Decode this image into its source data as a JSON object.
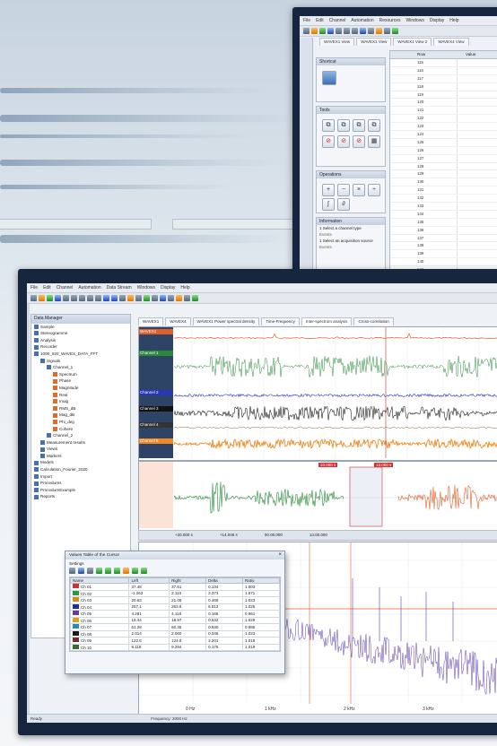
{
  "back_window": {
    "menu": [
      "File",
      "Edit",
      "Channel",
      "Automation",
      "Resources",
      "Windows",
      "Display",
      "Help"
    ],
    "tabs": [
      "WAVEX1 View",
      "WAVEX1 View",
      "WAVEX1 View 2",
      "WAVEX4 View"
    ],
    "panels": {
      "top": "Shortcut",
      "tools": "Tools",
      "ops": "Operations",
      "info": "Information"
    },
    "info_lines": [
      "1 Select a channel type",
      "Events",
      "1 Select an acquisition source",
      "Events"
    ],
    "ops_symbols": [
      "+",
      "−",
      "×",
      "÷",
      "∫",
      "∂"
    ],
    "table_headers": [
      "Row",
      "Value"
    ],
    "rows": [
      "115",
      "116",
      "117",
      "118",
      "119",
      "120",
      "121",
      "122",
      "123",
      "124",
      "125",
      "126",
      "127",
      "128",
      "129",
      "130",
      "131",
      "132",
      "133",
      "134",
      "135",
      "136",
      "137",
      "138",
      "139",
      "140",
      "141",
      "142"
    ]
  },
  "front_window": {
    "menu": [
      "File",
      "Edit",
      "Channel",
      "Automation",
      "Data Stream",
      "Windows",
      "Display",
      "Help"
    ],
    "tabs": [
      "WAVEX1",
      "WAVEX4",
      "WAVEX1 Power spectral density",
      "Time-Frequency",
      "Inter-spectrum analysis",
      "Cross-correlation"
    ],
    "tree_title": "Data Manager",
    "tree": [
      {
        "indent": 0,
        "label": "Sample"
      },
      {
        "indent": 0,
        "label": "Stereogramme"
      },
      {
        "indent": 0,
        "label": "Analysis"
      },
      {
        "indent": 0,
        "label": "Recorder"
      },
      {
        "indent": 0,
        "label": "1000_020_WAVEX_DATA_FFT"
      },
      {
        "indent": 1,
        "label": "Signals"
      },
      {
        "indent": 2,
        "label": "Channel_1"
      },
      {
        "indent": 3,
        "label": "Spectrum"
      },
      {
        "indent": 3,
        "label": "Phase"
      },
      {
        "indent": 3,
        "label": "Magnitude"
      },
      {
        "indent": 3,
        "label": "Real"
      },
      {
        "indent": 3,
        "label": "Imag"
      },
      {
        "indent": 3,
        "label": "RMS_dB"
      },
      {
        "indent": 3,
        "label": "Mag_dB"
      },
      {
        "indent": 3,
        "label": "Phi_deg"
      },
      {
        "indent": 3,
        "label": "Cohere"
      },
      {
        "indent": 2,
        "label": "Channel_2"
      },
      {
        "indent": 1,
        "label": "Measurement results"
      },
      {
        "indent": 1,
        "label": "Views"
      },
      {
        "indent": 1,
        "label": "Markers"
      },
      {
        "indent": 0,
        "label": "Models"
      },
      {
        "indent": 0,
        "label": "Calculation_Fourier_2020"
      },
      {
        "indent": 0,
        "label": "Import"
      },
      {
        "indent": 0,
        "label": "Procedures"
      },
      {
        "indent": 0,
        "label": "ProcedureExample"
      },
      {
        "indent": 0,
        "label": "Reports"
      }
    ],
    "channel_labels": [
      "WAVEX1",
      "Channel 1",
      "Channel 2",
      "Channel 3",
      "Channel 4",
      "Channel 5"
    ],
    "marker_readout": [
      "10.000 s",
      "13.000 s"
    ],
    "pos_readouts": [
      "+20.000 s",
      "+14.048 s",
      "00.00.000",
      "13.00.000"
    ],
    "dialog": {
      "title": "Values Table of the Cursor",
      "settings": "Settings",
      "headers": [
        "Name",
        "Left",
        "Right",
        "Delta",
        "Ratio"
      ],
      "rows": [
        {
          "color": "#d23232",
          "name": "Ch 01",
          "left": "37.48",
          "right": "37.61",
          "delta": "0.134",
          "ratio": "1.003"
        },
        {
          "color": "#2a9a3a",
          "name": "Ch 02",
          "left": "-1.263",
          "right": "2.110",
          "delta": "3.373",
          "ratio": "1.671"
        },
        {
          "color": "#d88a1c",
          "name": "Ch 03",
          "left": "20.63",
          "right": "21.09",
          "delta": "0.468",
          "ratio": "1.023"
        },
        {
          "color": "#1a2ea8",
          "name": "Ch 04",
          "left": "257.1",
          "right": "263.6",
          "delta": "6.512",
          "ratio": "1.025"
        },
        {
          "color": "#6a3a9a",
          "name": "Ch 05",
          "left": "4.281",
          "right": "4.116",
          "delta": "0.165",
          "ratio": "0.961"
        },
        {
          "color": "#e0a01c",
          "name": "Ch 06",
          "left": "18.44",
          "right": "18.97",
          "delta": "0.532",
          "ratio": "1.029"
        },
        {
          "color": "#2a8ab0",
          "name": "Ch 07",
          "left": "61.28",
          "right": "60.35",
          "delta": "0.930",
          "ratio": "0.985"
        },
        {
          "color": "#1a1a1a",
          "name": "Ch 08",
          "left": "2.014",
          "right": "2.060",
          "delta": "0.046",
          "ratio": "1.023"
        },
        {
          "color": "#7a2a2a",
          "name": "Ch 09",
          "left": "122.6",
          "right": "124.8",
          "delta": "2.201",
          "ratio": "1.018"
        },
        {
          "color": "#3a6a2a",
          "name": "Ch 10",
          "left": "9.118",
          "right": "9.294",
          "delta": "0.176",
          "ratio": "1.019"
        }
      ]
    },
    "spectrum_x_ticks": [
      "0 Hz",
      "1 kHz",
      "2 kHz",
      "3 kHz",
      "4 kHz"
    ],
    "status": "Ready",
    "status_readout": "Frequency: 2000 Hz",
    "colors": {
      "orange": "#e0602a",
      "green": "#2a8a3a",
      "blue": "#2a36b8",
      "black": "#111111",
      "amber": "#f08a20",
      "purple": "#5a3ab0",
      "panel_header": "#2e4466"
    }
  }
}
